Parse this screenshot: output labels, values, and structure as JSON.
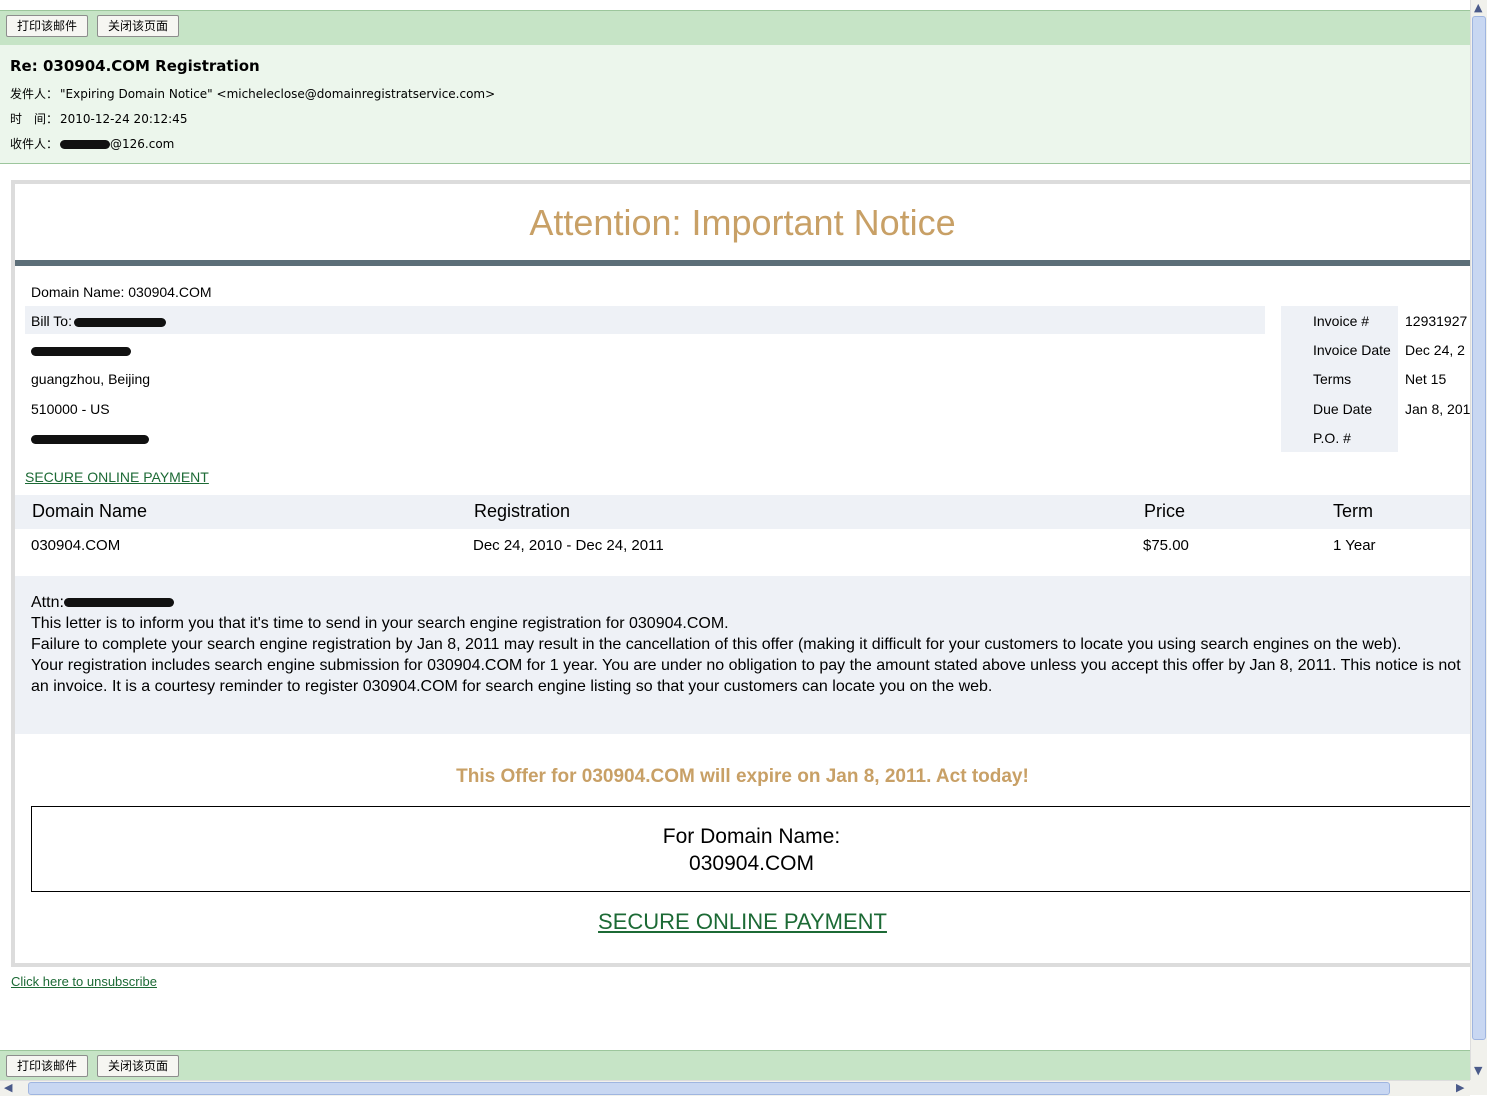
{
  "toolbar": {
    "print_label": "打印该邮件",
    "close_label": "关闭该页面"
  },
  "header": {
    "subject": "Re: 030904.COM Registration",
    "from_label": "发件人：",
    "from_value": "\"Expiring Domain Notice\" <micheleclose@domainregistratservice.com>",
    "time_label": "时　间：",
    "time_value": "2010-12-24 20:12:45",
    "to_label": "收件人：",
    "to_value_suffix": "@126.com"
  },
  "notice": {
    "heading": "Attention: Important Notice",
    "domain_line": "Domain Name: 030904.COM",
    "bill_to": "Bill To:",
    "city": "guangzhou, Beijing",
    "postal": "510000 - US",
    "secure_link": "SECURE ONLINE PAYMENT",
    "invoice": [
      {
        "label": "Invoice #",
        "value": "12931927"
      },
      {
        "label": "Invoice Date",
        "value": "Dec 24, 2"
      },
      {
        "label": "Terms",
        "value": "Net 15"
      },
      {
        "label": "Due Date",
        "value": "Jan 8, 201"
      },
      {
        "label": "P.O. #",
        "value": ""
      }
    ],
    "table": {
      "headers": [
        "Domain Name",
        "Registration",
        "Price",
        "Term"
      ],
      "row": [
        "030904.COM",
        "Dec 24, 2010 - Dec 24, 2011",
        "$75.00",
        "1 Year"
      ]
    },
    "message": {
      "attn": "Attn:",
      "line1": "This letter is to inform you that it's time to send in your search engine registration for 030904.COM.",
      "line2": "Failure to complete your search engine registration by Jan 8, 2011 may result in the cancellation of this offer (making it difficult for your customers to locate you using search engines on the web).",
      "line3": "Your registration includes search engine submission for 030904.COM for 1 year. You are under no obligation to pay the amount stated above unless you accept this offer by Jan 8, 2011. This notice is not an invoice. It is a courtesy reminder to register 030904.COM for search engine listing so that your customers can locate you on the web."
    },
    "offer": "This Offer for 030904.COM will expire on Jan 8, 2011. Act today!",
    "for_domain_label": "For Domain Name:",
    "for_domain_value": "030904.COM",
    "big_secure_link": "SECURE ONLINE PAYMENT"
  },
  "unsubscribe": "Click here to unsubscribe"
}
